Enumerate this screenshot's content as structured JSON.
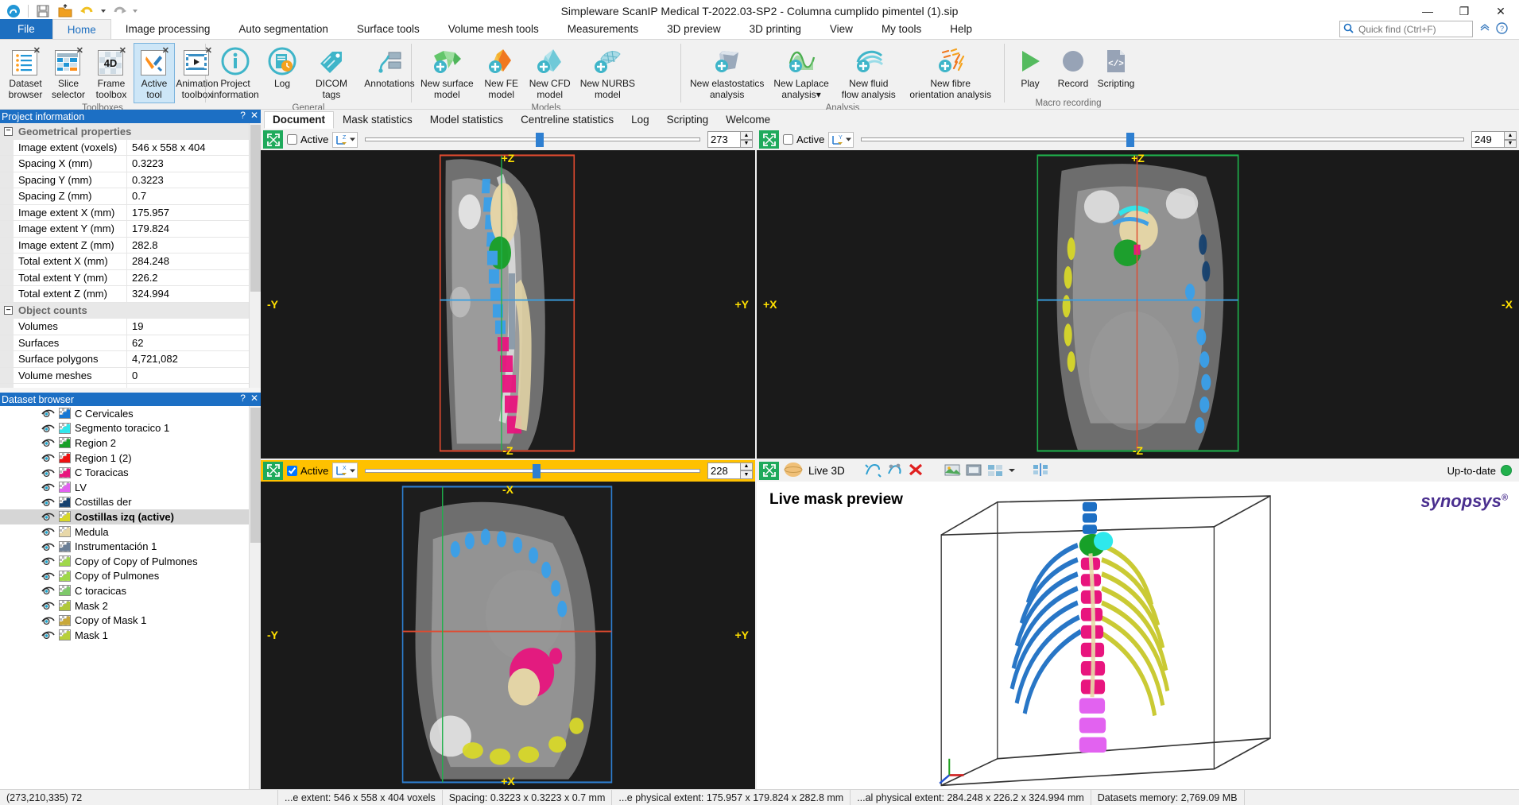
{
  "window": {
    "title": "Simpleware ScanIP Medical T-2022.03-SP2 - Columna cumplido pimentel (1).sip",
    "minimize": "—",
    "maximize": "❐",
    "close": "✕"
  },
  "quick_access": [
    {
      "name": "app-logo-icon",
      "label": ""
    },
    {
      "name": "save-icon",
      "label": ""
    },
    {
      "name": "open-icon",
      "label": ""
    },
    {
      "name": "undo-icon",
      "label": ""
    },
    {
      "name": "redo-icon",
      "label": ""
    }
  ],
  "ribbon_tabs": [
    {
      "label": "File",
      "id": "file"
    },
    {
      "label": "Home",
      "id": "home"
    },
    {
      "label": "Image processing",
      "id": "image-processing"
    },
    {
      "label": "Auto segmentation",
      "id": "auto-segmentation"
    },
    {
      "label": "Surface tools",
      "id": "surface-tools"
    },
    {
      "label": "Volume mesh tools",
      "id": "volume-mesh-tools"
    },
    {
      "label": "Measurements",
      "id": "measurements"
    },
    {
      "label": "3D preview",
      "id": "3d-preview"
    },
    {
      "label": "3D printing",
      "id": "3d-printing"
    },
    {
      "label": "View",
      "id": "view"
    },
    {
      "label": "My tools",
      "id": "my-tools"
    },
    {
      "label": "Help",
      "id": "help"
    }
  ],
  "active_ribbon_tab": "Home",
  "quick_find": {
    "placeholder": "Quick find (Ctrl+F)",
    "value": ""
  },
  "ribbon_groups": [
    {
      "label": "Toolboxes",
      "buttons": [
        {
          "label": "Dataset\nbrowser",
          "icon": "dataset-browser-icon",
          "selected": false
        },
        {
          "label": "Slice\nselector",
          "icon": "slice-selector-icon",
          "selected": false
        },
        {
          "label": "Frame\ntoolbox",
          "icon": "frame-toolbox-icon",
          "selected": false
        },
        {
          "label": "Active\ntool",
          "icon": "active-tool-icon",
          "selected": true
        },
        {
          "label": "Animation\ntoolbox",
          "icon": "animation-toolbox-icon",
          "selected": false
        }
      ]
    },
    {
      "label": "General",
      "buttons": [
        {
          "label": "Project\ninformation",
          "icon": "project-information-icon",
          "selected": false
        },
        {
          "label": "Log",
          "icon": "log-icon",
          "selected": false
        },
        {
          "label": "DICOM tags",
          "icon": "dicom-tags-icon",
          "selected": false
        },
        {
          "label": "Annotations",
          "icon": "annotations-icon",
          "selected": false
        }
      ]
    },
    {
      "label": "Models",
      "buttons": [
        {
          "label": "New surface\nmodel",
          "icon": "new-surface-model-icon",
          "selected": false
        },
        {
          "label": "New FE\nmodel",
          "icon": "new-fe-model-icon",
          "selected": false
        },
        {
          "label": "New CFD\nmodel",
          "icon": "new-cfd-model-icon",
          "selected": false
        },
        {
          "label": "New NURBS\nmodel",
          "icon": "new-nurbs-model-icon",
          "selected": false
        }
      ]
    },
    {
      "label": "Analysis",
      "buttons": [
        {
          "label": "New elastostatics\nanalysis",
          "icon": "new-elastostatics-analysis-icon",
          "selected": false
        },
        {
          "label": "New Laplace\nanalysis▾",
          "icon": "new-laplace-analysis-icon",
          "selected": false
        },
        {
          "label": "New fluid\nflow analysis",
          "icon": "new-fluid-flow-analysis-icon",
          "selected": false
        },
        {
          "label": "New fibre\norientation analysis",
          "icon": "new-fibre-orientation-analysis-icon",
          "selected": false
        }
      ]
    },
    {
      "label": "Macro recording",
      "buttons": [
        {
          "label": "Play",
          "icon": "play-icon",
          "selected": false
        },
        {
          "label": "Record",
          "icon": "record-icon",
          "selected": false
        },
        {
          "label": "Scripting",
          "icon": "scripting-icon",
          "selected": false
        }
      ]
    }
  ],
  "project_information": {
    "panel_title": "Project information",
    "help_btn": "?",
    "close_btn": "✕",
    "groups": [
      {
        "name": "Geometrical properties",
        "rows": [
          {
            "key": "Image extent (voxels)",
            "value": "546 x 558 x 404"
          },
          {
            "key": "Spacing X (mm)",
            "value": "0.3223"
          },
          {
            "key": "Spacing Y (mm)",
            "value": "0.3223"
          },
          {
            "key": "Spacing Z (mm)",
            "value": "0.7"
          },
          {
            "key": "Image extent X (mm)",
            "value": "175.957"
          },
          {
            "key": "Image extent Y (mm)",
            "value": "179.824"
          },
          {
            "key": "Image extent Z (mm)",
            "value": "282.8"
          },
          {
            "key": "Total extent X (mm)",
            "value": "284.248"
          },
          {
            "key": "Total extent Y (mm)",
            "value": "226.2"
          },
          {
            "key": "Total extent Z (mm)",
            "value": "324.994"
          }
        ]
      },
      {
        "name": "Object counts",
        "rows": [
          {
            "key": "Volumes",
            "value": "19"
          },
          {
            "key": "Surfaces",
            "value": "62"
          },
          {
            "key": "Surface polygons",
            "value": "4,721,082"
          },
          {
            "key": "Volume meshes",
            "value": "0"
          }
        ]
      }
    ]
  },
  "dataset_browser": {
    "panel_title": "Dataset browser",
    "help_btn": "?",
    "close_btn": "✕",
    "items": [
      {
        "label": "C Cervicales",
        "color": "#1878d4",
        "active": false
      },
      {
        "label": "Segmento toracico 1",
        "color": "#2ee8ec",
        "active": false
      },
      {
        "label": "Region 2",
        "color": "#17a028",
        "active": false
      },
      {
        "label": "Region 1 (2)",
        "color": "#ee1111",
        "active": false
      },
      {
        "label": "C Toracicas",
        "color": "#e8157e",
        "active": false
      },
      {
        "label": "LV",
        "color": "#e262f0",
        "active": false
      },
      {
        "label": "Costillas der",
        "color": "#16416f",
        "active": false
      },
      {
        "label": "Costillas izq (active)",
        "color": "#d8d82a",
        "active": true
      },
      {
        "label": "Medula",
        "color": "#e8d8a8",
        "active": false
      },
      {
        "label": "Instrumentación 1",
        "color": "#6b7f96",
        "active": false
      },
      {
        "label": "Copy of Copy of Pulmones",
        "color": "#9fd84a",
        "active": false
      },
      {
        "label": "Copy of Pulmones",
        "color": "#9fd84a",
        "active": false
      },
      {
        "label": "C toracicas",
        "color": "#7ec96a",
        "active": false
      },
      {
        "label": "Mask 2",
        "color": "#b0c83a",
        "active": false
      },
      {
        "label": "Copy of Mask 1",
        "color": "#c8a83a",
        "active": false
      },
      {
        "label": "Mask 1",
        "color": "#b8d03a",
        "active": false
      }
    ]
  },
  "document_tabs": [
    {
      "label": "Document",
      "active": true
    },
    {
      "label": "Mask statistics",
      "active": false
    },
    {
      "label": "Model statistics",
      "active": false
    },
    {
      "label": "Centreline statistics",
      "active": false
    },
    {
      "label": "Log",
      "active": false
    },
    {
      "label": "Scripting",
      "active": false
    },
    {
      "label": "Welcome",
      "active": false
    }
  ],
  "views": {
    "top_left": {
      "name": "coronal-view",
      "active_label": "Active",
      "active_checked": false,
      "slice_value": "273",
      "slice_percent": 52,
      "axis_labels": {
        "top": "+Z",
        "bottom": "-Z",
        "left": "-Y",
        "right": "+Y"
      },
      "axis_icon": "axis-z-icon",
      "expand_icon": "expand-icon",
      "bar_highlight": false
    },
    "top_right": {
      "name": "axial-view",
      "active_label": "Active",
      "active_checked": false,
      "slice_value": "249",
      "slice_percent": 44,
      "axis_labels": {
        "top": "+Z",
        "bottom": "-Z",
        "left": "+X",
        "right": "-X"
      },
      "axis_icon": "axis-y-icon",
      "expand_icon": "expand-icon",
      "bar_highlight": false
    },
    "bottom_left": {
      "name": "sagittal-view",
      "active_label": "Active",
      "active_checked": true,
      "slice_value": "228",
      "slice_percent": 51,
      "axis_labels": {
        "top": "-X",
        "bottom": "+X",
        "left": "-Y",
        "right": "+Y"
      },
      "axis_icon": "axis-x-icon",
      "expand_icon": "expand-icon",
      "bar_highlight": true
    },
    "bottom_right": {
      "name": "live-3d-view",
      "live3d_label": "Live 3D",
      "status_label": "Up-to-date",
      "preview_title": "Live mask preview",
      "brand": "synopsys",
      "brand_mark": "®",
      "expand_icon": "expand-icon",
      "toolbar_icons": [
        "mask-preview-toggle-icon",
        "surface-preview-icon",
        "clear-preview-icon",
        "screenshot-icon",
        "movie-icon",
        "settings-grid-icon",
        "chevron-down-icon",
        "align-icon"
      ]
    }
  },
  "status_bar": {
    "cursor": "(273,210,335) 72",
    "image_extent": "...e extent: 546 x 558 x 404 voxels",
    "spacing": "Spacing: 0.3223 x 0.3223 x 0.7 mm",
    "physical_extent": "...e physical extent: 175.957 x 179.824 x 282.8 mm",
    "total_physical_extent": "...al physical extent: 284.248 x 226.2 x 324.994 mm",
    "memory": "Datasets memory: 2,769.09 MB"
  }
}
